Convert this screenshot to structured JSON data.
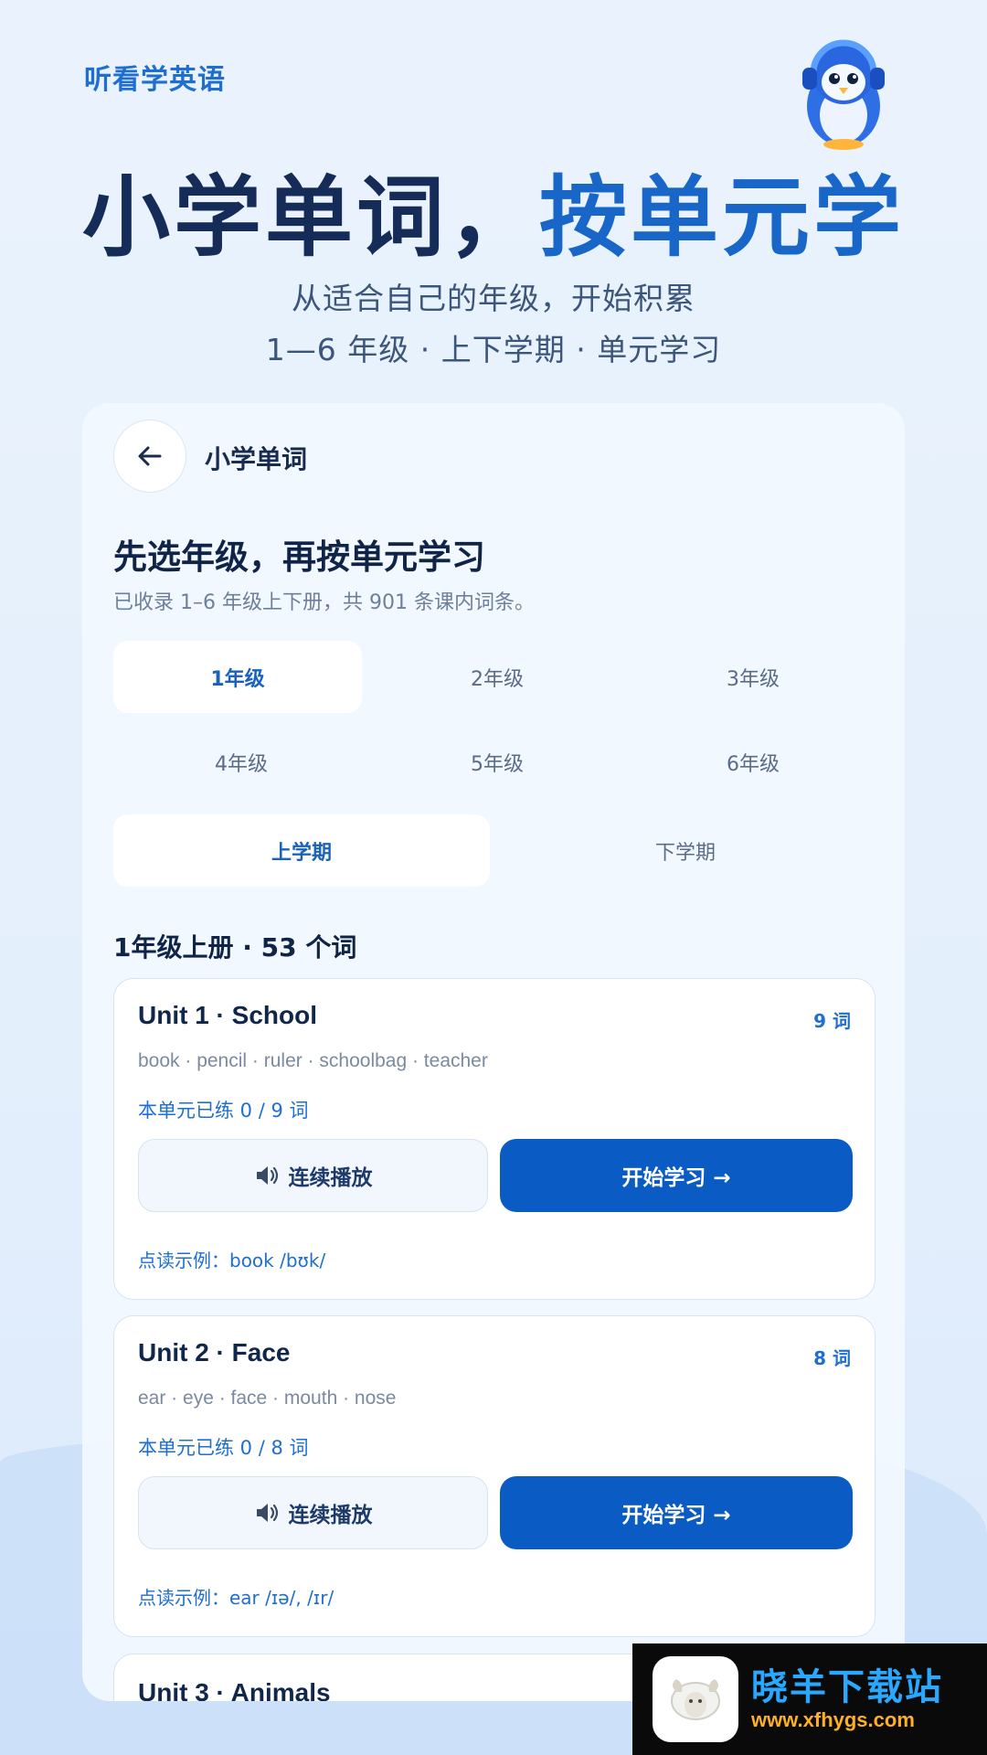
{
  "header": {
    "brand": "听看学英语",
    "title_part1": "小学单词，",
    "title_part2": "按单元学",
    "subtitle1": "从适合自己的年级，开始积累",
    "subtitle2": "1—6 年级 · 上下学期 · 单元学习"
  },
  "panel": {
    "title": "小学单词",
    "heading": "先选年级，再按单元学习",
    "description": "已收录 1–6 年级上下册，共 901 条课内词条。",
    "grades": [
      "1年级",
      "2年级",
      "3年级",
      "4年级",
      "5年级",
      "6年级"
    ],
    "selected_grade": "1年级",
    "terms": [
      "上学期",
      "下学期"
    ],
    "selected_term": "上学期",
    "summary": "1年级上册 · 53 个词",
    "play_label": "连续播放",
    "start_label": "开始学习 →",
    "units": [
      {
        "title": "Unit 1 · School",
        "count": "9 词",
        "words": "book · pencil · ruler · schoolbag · teacher",
        "progress": "本单元已练 0 / 9 词",
        "example": "点读示例：book  /bʊk/"
      },
      {
        "title": "Unit 2 · Face",
        "count": "8 词",
        "words": "ear · eye · face · mouth · nose",
        "progress": "本单元已练 0 / 8 词",
        "example": "点读示例：ear  /ɪə/, /ɪr/"
      },
      {
        "title": "Unit 3 · Animals"
      }
    ]
  },
  "watermark": {
    "name": "晓羊下载站",
    "url": "www.xfhygs.com"
  },
  "colors": {
    "accent": "#1766c8",
    "primary_button": "#0a5bc4",
    "title_dark": "#142c57"
  }
}
